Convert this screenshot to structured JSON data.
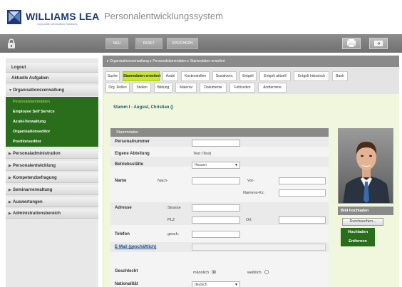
{
  "header": {
    "logo_text": "WILLIAMS LEA",
    "logo_sub": "Corporate Information Solutions",
    "app_title": "Personalentwicklungssystem"
  },
  "toolbar": {
    "buttons": [
      "NEU",
      "RESET",
      "SPEICHERN"
    ]
  },
  "sidebar": {
    "items": [
      {
        "label": "Logout"
      },
      {
        "label": "Aktuelle Aufgaben"
      },
      {
        "label": "Organisationsverwaltung"
      },
      {
        "label": "Personaladministration"
      },
      {
        "label": "Personalentwicklung"
      },
      {
        "label": "Kompetenzbefragung"
      },
      {
        "label": "Seminarverwaltung"
      },
      {
        "label": "Auswertungen"
      },
      {
        "label": "Administrationsbereich"
      }
    ],
    "sub_items": [
      {
        "label": "Personalstammdaten"
      },
      {
        "label": "Employee Self Service"
      },
      {
        "label": "Azubi-Verwaltung"
      },
      {
        "label": "Organisationseditor"
      },
      {
        "label": "Positionseditor"
      }
    ]
  },
  "breadcrumb": "▸ Organisationsverwaltung ▸ Personalstammdaten ▸ Stammdaten erweitert",
  "tabs": {
    "row1": [
      "Suche",
      "Stammdaten erweitert",
      "Azubi",
      "Kostenstellen",
      "Sozialvers.",
      "Entgelt",
      "Entgelt aktuell",
      "Entgelt historisch",
      "Bank"
    ],
    "row2": [
      "Org. Rollen",
      "Stellen",
      "Bildung",
      "Material",
      "Dokumente",
      "Fehlzeiten",
      "Arzttermine"
    ]
  },
  "content": {
    "person": "Stamm I - August, Christian ()",
    "section": "Stammdaten",
    "fields": {
      "personalnummer": "Personalnummer",
      "abteilung": "Eigene Abteilung",
      "abteilung_value": "Test (Test)",
      "betriebsstaette": "Betriebsstätte",
      "betriebsstaette_value": "Hessen",
      "name": "Name",
      "nach": "Nach-",
      "vor": "Vor-",
      "namens_kz": "Namens-Kz.",
      "adresse": "Adresse",
      "strasse": "Strasse",
      "plz": "PLZ",
      "ort": "Ort",
      "telefon": "Telefon",
      "gesch": "gesch.",
      "email": "E-Mail (geschäftlich)",
      "geschlecht": "Geschlecht",
      "maennlich": "männlich",
      "weiblich": "weiblich",
      "nationalitaet": "Nationalität",
      "nationalitaet_value": "deutsch"
    }
  },
  "photo_panel": {
    "head": "Bild hochladen",
    "browse": "Durchsuchen...",
    "upload": "Hochladen",
    "remove": "Entfernen"
  },
  "colors": {
    "tab_active": "#c8e632",
    "nav_green": "#2a6e1c",
    "content_bg": "#f0f7dd"
  }
}
